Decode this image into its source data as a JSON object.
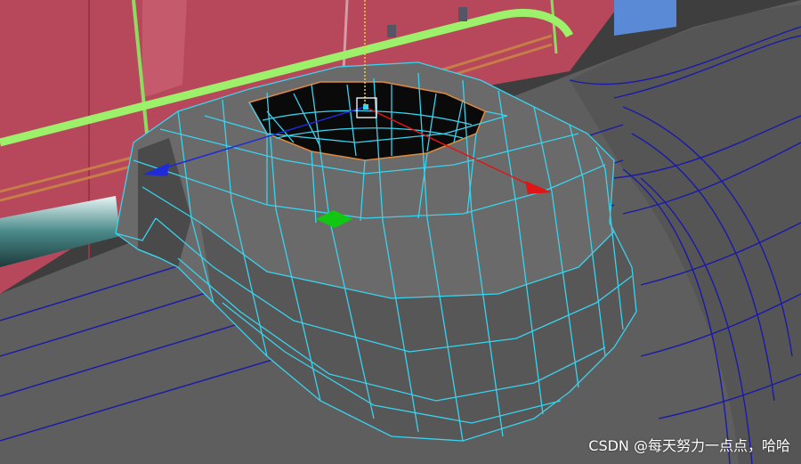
{
  "watermark": {
    "text": "CSDN @每天努力一点点，哈哈"
  },
  "colors": {
    "wireframe_selected": "#39d3ee",
    "wireframe_body": "#1a1aa8",
    "background_red": "#b5475a",
    "pipe_green": "#9cf06a",
    "pipe_orange": "#c77d48",
    "gizmo_x": "#e01515",
    "gizmo_y": "#12c712",
    "gizmo_z": "#1e2bd6"
  },
  "icons": {
    "move_gizmo": "move-gizmo-icon",
    "pivot_handle": "pivot-handle-icon"
  }
}
